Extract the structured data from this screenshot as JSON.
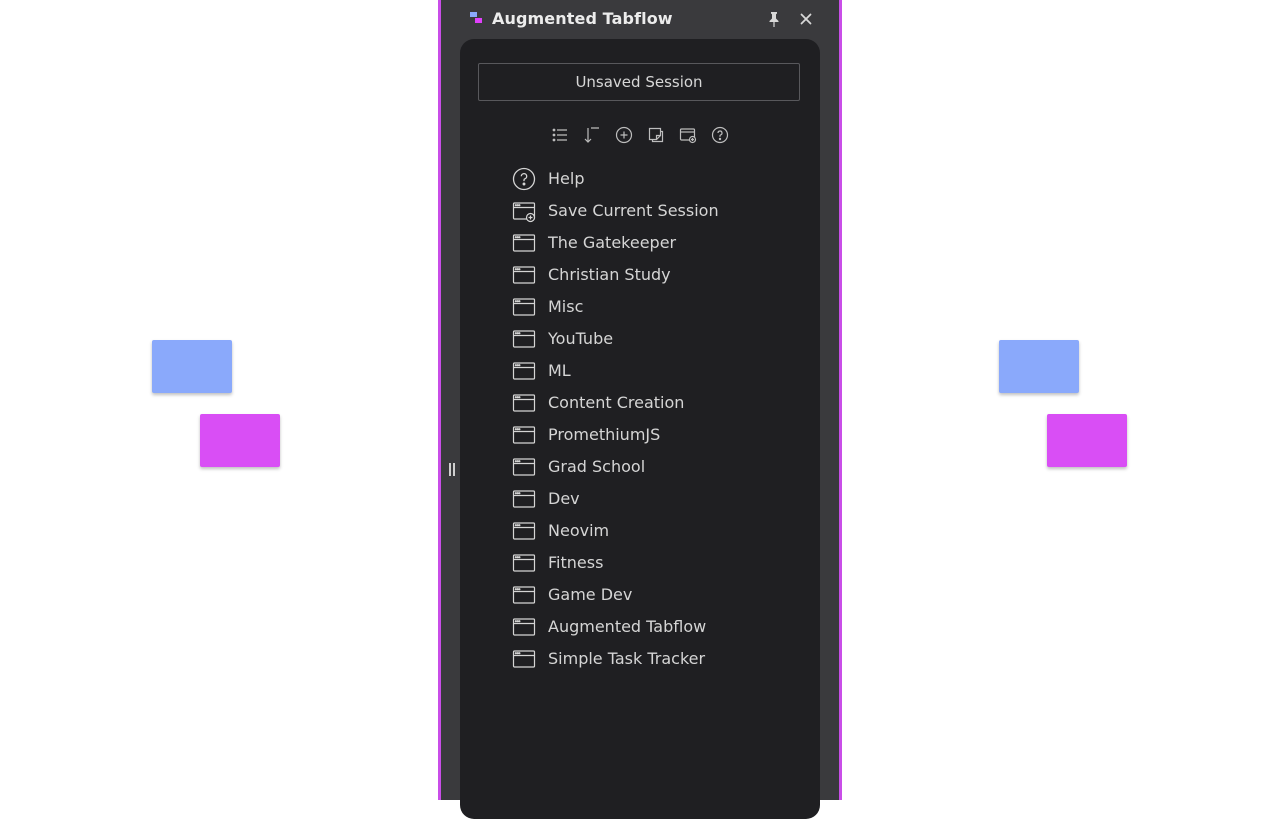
{
  "app": {
    "title": "Augmented Tabflow",
    "accent_color": "#c94ee8",
    "pin_icon": "pin-icon",
    "close_icon": "close-icon"
  },
  "session": {
    "name": "Unsaved Session"
  },
  "toolbar": [
    {
      "icon": "list-icon"
    },
    {
      "icon": "sort-icon"
    },
    {
      "icon": "add-circle-icon"
    },
    {
      "icon": "duplicate-icon"
    },
    {
      "icon": "save-session-icon"
    },
    {
      "icon": "help-icon"
    }
  ],
  "sessions": {
    "help_label": "Help",
    "save_label": "Save Current Session",
    "items": [
      "The Gatekeeper",
      "Christian Study",
      "Misc",
      "YouTube",
      "ML",
      "Content Creation",
      "PromethiumJS",
      "Grad School",
      "Dev",
      "Neovim",
      "Fitness",
      "Game Dev",
      "Augmented Tabflow",
      "Simple Task Tracker"
    ]
  },
  "background_colors": {
    "blue": "#8aa9fb",
    "pink": "#d94ef5"
  }
}
